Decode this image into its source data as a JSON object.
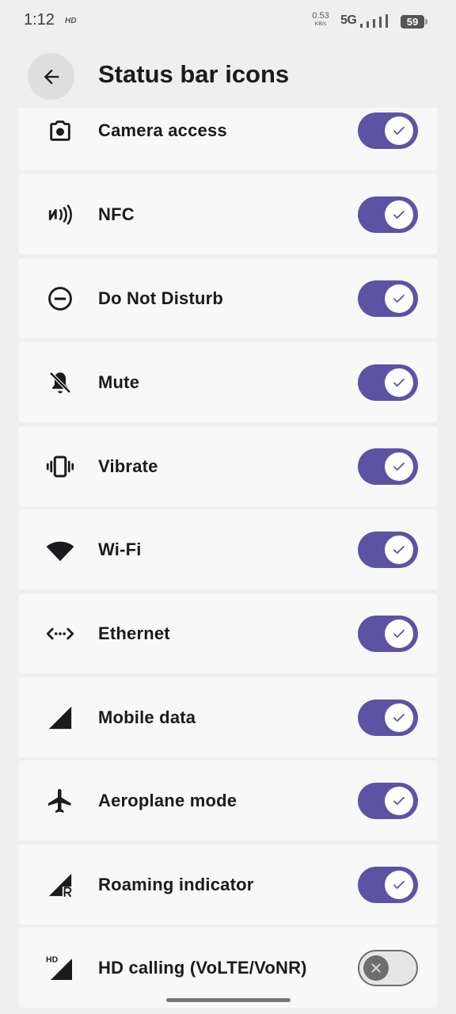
{
  "status_bar": {
    "time": "1:12",
    "hd_label": "HD",
    "net_speed_value": "0.53",
    "net_speed_unit": "KB/s",
    "network": "5G",
    "battery": "59"
  },
  "header": {
    "title": "Status bar icons",
    "back_icon": "arrow-back-icon"
  },
  "colors": {
    "switch_on": "#5c53a5",
    "switch_off_track": "#e6e6e6",
    "switch_off_thumb": "#6f6f6f",
    "card_bg": "#f8f8f8",
    "page_bg": "#efefef"
  },
  "items": [
    {
      "label": "Camera access",
      "icon": "camera-icon",
      "enabled": true
    },
    {
      "label": "NFC",
      "icon": "nfc-icon",
      "enabled": true
    },
    {
      "label": "Do Not Disturb",
      "icon": "do-not-disturb-icon",
      "enabled": true
    },
    {
      "label": "Mute",
      "icon": "mute-bell-icon",
      "enabled": true
    },
    {
      "label": "Vibrate",
      "icon": "vibrate-icon",
      "enabled": true
    },
    {
      "label": "Wi-Fi",
      "icon": "wifi-icon",
      "enabled": true
    },
    {
      "label": "Ethernet",
      "icon": "ethernet-icon",
      "enabled": true
    },
    {
      "label": "Mobile data",
      "icon": "mobile-data-icon",
      "enabled": true
    },
    {
      "label": "Aeroplane mode",
      "icon": "aeroplane-icon",
      "enabled": true
    },
    {
      "label": "Roaming indicator",
      "icon": "roaming-icon",
      "enabled": true
    },
    {
      "label": "HD calling (VoLTE/VoNR)",
      "icon": "hd-calling-icon",
      "icon_text": "HD",
      "enabled": false
    }
  ]
}
